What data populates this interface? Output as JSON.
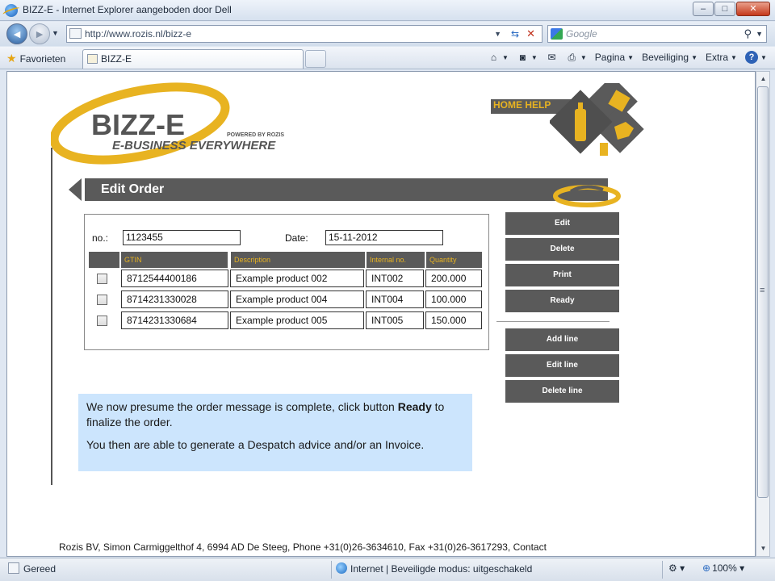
{
  "window": {
    "title": "BIZZ-E - Internet Explorer aangeboden door Dell",
    "min_label": "‒",
    "max_label": "□",
    "close_label": "✕"
  },
  "address": {
    "url": "http://www.rozis.nl/bizz-e",
    "search_placeholder": "Google"
  },
  "favorites": {
    "label": "Favorieten",
    "tab_title": "BIZZ-E"
  },
  "command_bar": {
    "page": "Pagina",
    "safety": "Beveiliging",
    "extra": "Extra"
  },
  "logo": {
    "brand": "BIZZ-E",
    "tagline": "E-BUSINESS EVERYWHERE",
    "powered": "POWERED BY ROZIS"
  },
  "header": {
    "home_help": "HOME HELP",
    "title": "Edit Order"
  },
  "order": {
    "no_label": "no.:",
    "no_value": "1123455",
    "date_label": "Date:",
    "date_value": "15-11-2012",
    "columns": [
      "GTIN",
      "Description",
      "Internal no.",
      "Quantity"
    ],
    "rows": [
      {
        "gtin": "8712544400186",
        "description": "Example product 002",
        "internal": "INT002",
        "quantity": "200.000"
      },
      {
        "gtin": "8714231330028",
        "description": "Example product 004",
        "internal": "INT004",
        "quantity": "100.000"
      },
      {
        "gtin": "8714231330684",
        "description": "Example product 005",
        "internal": "INT005",
        "quantity": "150.000"
      }
    ]
  },
  "actions": {
    "edit": "Edit",
    "delete": "Delete",
    "print": "Print",
    "ready": "Ready",
    "add_line": "Add line",
    "edit_line": "Edit line",
    "delete_line": "Delete line"
  },
  "note": {
    "line1_pre": "We now presume the order message is complete, click button ",
    "line1_bold": "Ready",
    "line1_post": " to finalize the order.",
    "line2": "You then are able to generate a Despatch advice and/or an Invoice."
  },
  "footer": "Rozis BV, Simon Carmiggelthof 4, 6994 AD De Steeg, Phone +31(0)26-3634610, Fax +31(0)26-3617293, Contact",
  "status": {
    "ready": "Gereed",
    "zone": "Internet | Beveiligde modus: uitgeschakeld",
    "zoom": "100%"
  },
  "colors": {
    "accent_yellow": "#e8b321",
    "bar_gray": "#5a5a5a",
    "note_blue": "#cce5fd"
  }
}
